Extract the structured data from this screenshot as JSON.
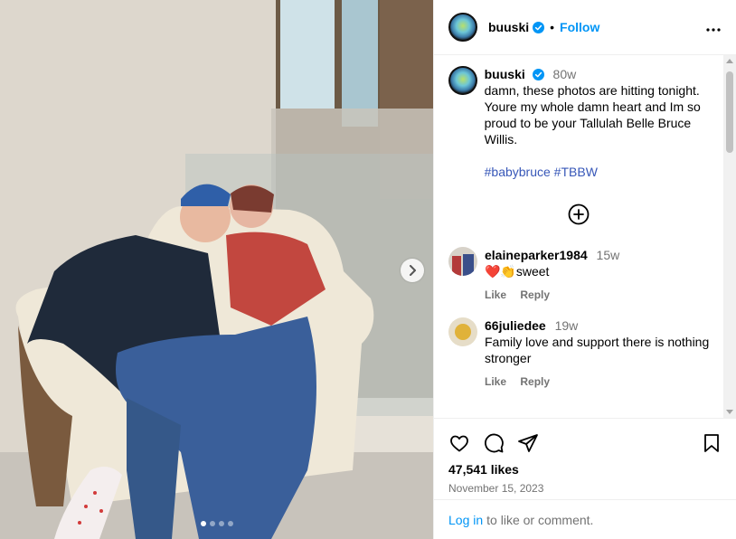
{
  "post": {
    "username": "buuski",
    "follow_label": "Follow",
    "separator": "•",
    "more_label": "•••"
  },
  "caption": {
    "username": "buuski",
    "time": "80w",
    "text": "damn, these photos are hitting tonight. Youre my whole damn heart and Im so proud to be your Tallulah Belle Bruce Willis.",
    "hashtags": "#babybruce #TBBW"
  },
  "comments": [
    {
      "username": "elaineparker1984",
      "time": "15w",
      "emoji": "❤️👏",
      "text": "sweet",
      "like_label": "Like",
      "reply_label": "Reply"
    },
    {
      "username": "66juliedee",
      "time": "19w",
      "text": "Family love and support there is nothing stronger",
      "like_label": "Like",
      "reply_label": "Reply"
    }
  ],
  "stats": {
    "likes": "47,541 likes",
    "date": "November 15, 2023"
  },
  "login": {
    "link_label": "Log in",
    "suffix": "to like or comment."
  },
  "carousel": {
    "dot_count": 4,
    "active_index": 0
  },
  "colors": {
    "follow": "#0095f6",
    "hashtag": "#3757b8",
    "muted": "#737373"
  },
  "icons": [
    "more-icon",
    "verified-icon",
    "add-comment-icon",
    "heart-icon",
    "comment-icon",
    "share-icon",
    "save-icon",
    "next-arrow-icon"
  ]
}
